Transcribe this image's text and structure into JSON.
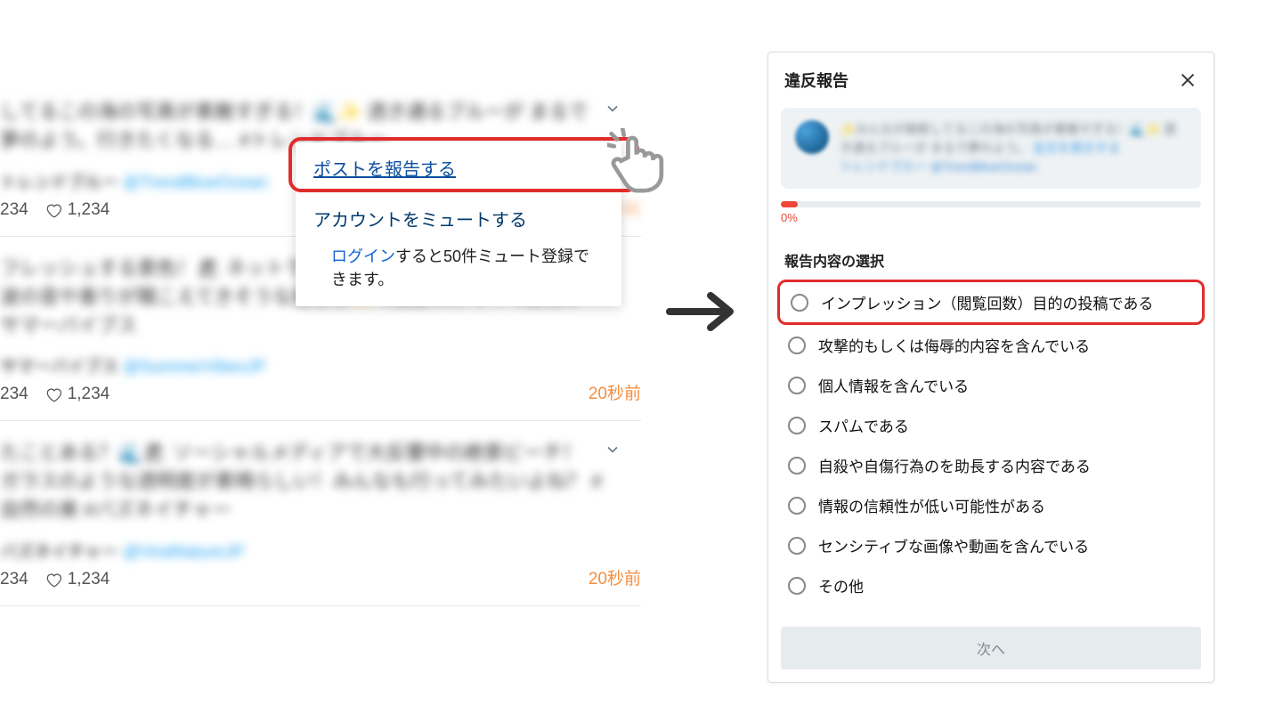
{
  "feed": {
    "posts": [
      {
        "text": "してるこの海の写真が素敵すぎる！🌊✨ 透き通るブルーが まるで夢のよう。行きたくなる… #トレンドブルー",
        "username": "トレンドブルー",
        "handle": "@TrendBlueOcean",
        "count1": "234",
        "likes": "1,234",
        "time": "20秒前"
      },
      {
        "text": "フレッシュする景色！🏖 ネットで話題のこのビーチ、行ってみたい 波の音や香りが聞こえてきそうな美しさ✨ #絶景スポット #美しい サマーバイブス",
        "username": "サマーバイブス",
        "handle": "@SummerVibesJP",
        "count1": "234",
        "likes": "1,234",
        "time": "20秒前"
      },
      {
        "text": "たことある？🌊🏖 ソーシャルメディアで大反響中の絶景ビーチ！ ガラスのような透明度が素晴らしい！みんなも行ってみたいよね？ #自然の美 #バズネイチャー",
        "username": "バズネイチャー",
        "handle": "@ViralNatureJP",
        "count1": "234",
        "likes": "1,234",
        "time": "20秒前"
      }
    ]
  },
  "dropdown": {
    "report_label": "ポストを報告する",
    "mute_label": "アカウントをミュートする",
    "login_link": "ログイン",
    "login_suffix": "すると50件ミュート登録できます。"
  },
  "modal": {
    "title": "違反報告",
    "preview_text_a": "✨みんなが検索してるこの海の写真が素敵すぎる！🌊✨ 透き通るブルーが まるで夢のよう。",
    "preview_text_link": "全文を表示する",
    "preview_text_b": "トレンドブルー ",
    "preview_text_handle": "@TrendBlueOcean",
    "progress_pct": "0%",
    "progress_width": "4%",
    "section_label": "報告内容の選択",
    "options": [
      "インプレッション（閲覧回数）目的の投稿である",
      "攻撃的もしくは侮辱的内容を含んでいる",
      "個人情報を含んでいる",
      "スパムである",
      "自殺や自傷行為のを助長する内容である",
      "情報の信頼性が低い可能性がある",
      "センシティブな画像や動画を含んでいる",
      "その他"
    ],
    "next_label": "次へ"
  }
}
